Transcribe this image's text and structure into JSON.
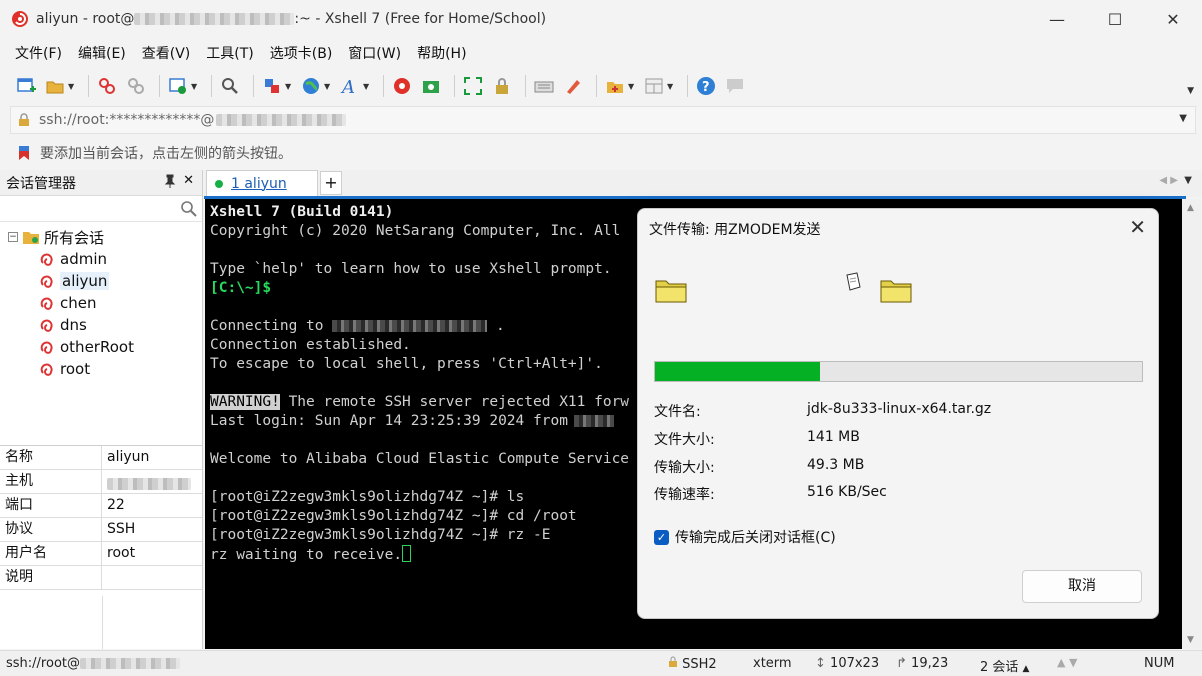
{
  "window": {
    "title_prefix": "aliyun - root@",
    "title_suffix": ":~ - Xshell 7 (Free for Home/School)",
    "minimize": "—",
    "maximize": "☐",
    "close": "✕"
  },
  "menu": [
    "文件(F)",
    "编辑(E)",
    "查看(V)",
    "工具(T)",
    "选项卡(B)",
    "窗口(W)",
    "帮助(H)"
  ],
  "address": {
    "value": "ssh://root:*************@"
  },
  "hint": {
    "text": "要添加当前会话，点击左侧的箭头按钮。"
  },
  "session_manager": {
    "title": "会话管理器",
    "pin": "📌",
    "close": "✕",
    "search_placeholder": "",
    "root_label": "所有会话",
    "sessions": [
      "admin",
      "aliyun",
      "chen",
      "dns",
      "otherRoot",
      "root"
    ]
  },
  "properties": [
    {
      "key": "名称",
      "value": "aliyun"
    },
    {
      "key": "主机",
      "value": ""
    },
    {
      "key": "端口",
      "value": "22"
    },
    {
      "key": "协议",
      "value": "SSH"
    },
    {
      "key": "用户名",
      "value": "root"
    },
    {
      "key": "说明",
      "value": ""
    }
  ],
  "tabs": [
    {
      "label": "1 aliyun",
      "active": true
    }
  ],
  "tab_add": "+",
  "terminal": {
    "line1": "Xshell 7 (Build 0141)",
    "line2": "Copyright (c) 2020 NetSarang Computer, Inc. All",
    "line4": "Type `help' to learn how to use Xshell prompt.",
    "line5": "[C:\\~]$",
    "line7a": "Connecting to ",
    "line7b": ".",
    "line8": "Connection established.",
    "line9": "To escape to local shell, press 'Ctrl+Alt+]'.",
    "line11a": "WARNING!",
    "line11b": " The remote SSH server rejected X11 forw",
    "line12a": "Last login: Sun Apr 14 23:25:39 2024 from",
    "line14": "Welcome to Alibaba Cloud Elastic Compute Service",
    "line16": "[root@iZ2zegw3mkls9olizhdg74Z ~]# ls",
    "line17": "[root@iZ2zegw3mkls9olizhdg74Z ~]# cd /root",
    "line18": "[root@iZ2zegw3mkls9olizhdg74Z ~]# rz -E",
    "line19": "rz waiting to receive."
  },
  "status": {
    "conn": "ssh://root@",
    "proto": "SSH2",
    "term": "xterm",
    "size": "107x23",
    "pos": "19,23",
    "sessions": "2 会话",
    "caps": "NUM"
  },
  "dialog": {
    "title": "文件传输: 用ZMODEM发送",
    "close": "✕",
    "progress": 0.338,
    "rows": [
      {
        "label": "文件名:",
        "value": "jdk-8u333-linux-x64.tar.gz"
      },
      {
        "label": "文件大小:",
        "value": "141 MB"
      },
      {
        "label": "传输大小:",
        "value": "49.3 MB"
      },
      {
        "label": "传输速率:",
        "value": "516 KB/Sec"
      }
    ],
    "checkbox_label": "传输完成后关闭对话框(C)",
    "checkbox_checked": true,
    "cancel": "取消"
  },
  "colors": {
    "accent": "#1a6fc8",
    "progress": "#06b025",
    "prompt_green": "#27d95c",
    "terminal_bg": "#000000"
  }
}
